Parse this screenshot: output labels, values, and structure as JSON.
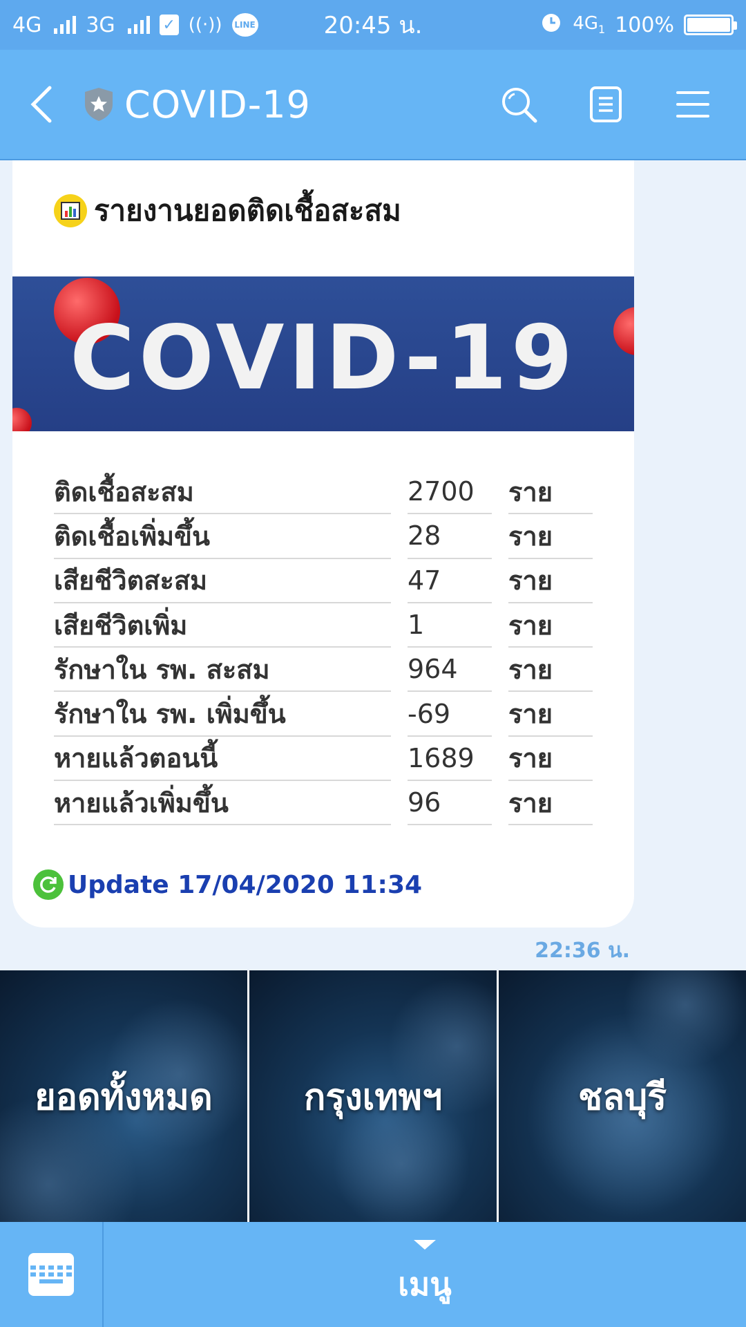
{
  "status_bar": {
    "sim1": "4G",
    "sim2": "3G",
    "time": "20:45 น.",
    "network_right": "4G",
    "network_sub": "1",
    "battery": "100%",
    "icons": [
      "signal-icon",
      "calendar-check-icon",
      "hotspot-icon",
      "line-icon",
      "alarm-icon",
      "battery-icon"
    ],
    "line_label": "LINE"
  },
  "header": {
    "title": "COVID-19",
    "icons": [
      "back-icon",
      "shield-star-icon",
      "search-icon",
      "notes-icon",
      "menu-icon"
    ]
  },
  "card": {
    "title": "รายงานยอดติดเชื้อสะสม",
    "banner_text": "COVID-19",
    "stats": [
      {
        "label": "ติดเชื้อสะสม",
        "value": "2700",
        "unit": "ราย"
      },
      {
        "label": "ติดเชื้อเพิ่มขึ้น",
        "value": "28",
        "unit": "ราย"
      },
      {
        "label": "เสียชีวิตสะสม",
        "value": "47",
        "unit": "ราย"
      },
      {
        "label": "เสียชีวิตเพิ่ม",
        "value": "1",
        "unit": "ราย"
      },
      {
        "label": "รักษาใน รพ. สะสม",
        "value": "964",
        "unit": "ราย"
      },
      {
        "label": "รักษาใน รพ. เพิ่มขึ้น",
        "value": "-69",
        "unit": "ราย"
      },
      {
        "label": "หายแล้วตอนนี้",
        "value": "1689",
        "unit": "ราย"
      },
      {
        "label": "หายแล้วเพิ่มขึ้น",
        "value": "96",
        "unit": "ราย"
      }
    ],
    "update_text": "Update 17/04/2020 11:34"
  },
  "message_time": "22:36 น.",
  "rich_menu": {
    "items": [
      {
        "label": "ยอดทั้งหมด"
      },
      {
        "label": "กรุงเทพฯ"
      },
      {
        "label": "ชลบุรี"
      }
    ]
  },
  "bottom_bar": {
    "menu_label": "เมนู"
  },
  "colors": {
    "header": "#66b5f5",
    "status_bar": "#5ea9ee",
    "update_text": "#1a3fb0",
    "banner": "#2e4f98"
  }
}
